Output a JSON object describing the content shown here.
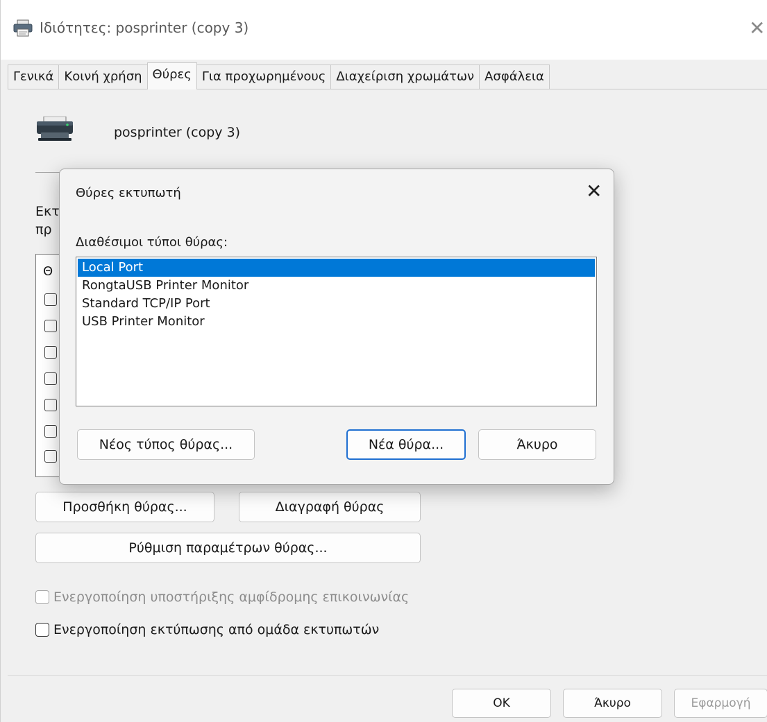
{
  "window": {
    "title": "Ιδιότητες: posprinter (copy 3)",
    "close_glyph": "✕"
  },
  "tabs": [
    {
      "label": "Γενικά",
      "active": false
    },
    {
      "label": "Κοινή χρήση",
      "active": false
    },
    {
      "label": "Θύρες",
      "active": true
    },
    {
      "label": "Για προχωρημένους",
      "active": false
    },
    {
      "label": "Διαχείριση χρωμάτων",
      "active": false
    },
    {
      "label": "Ασφάλεια",
      "active": false
    }
  ],
  "ports_page": {
    "printer_name": "posprinter (copy 3)",
    "partial_label_line1": "Εκτ",
    "partial_label_line2": "πρ",
    "column_header_partial": "Θ",
    "add_port_label": "Προσθήκη θύρας...",
    "delete_port_label": "Διαγραφή θύρας",
    "configure_port_label": "Ρύθμιση παραμέτρων θύρας...",
    "bidirectional_label": "Ενεργοποίηση υποστήριξης αμφίδρομης επικοινωνίας",
    "pooling_label": "Ενεργοποίηση εκτύπωσης από ομάδα εκτυπωτών"
  },
  "footer": {
    "ok_label": "OK",
    "cancel_label": "Άκυρο",
    "apply_label": "Εφαρμογή"
  },
  "dialog": {
    "title": "Θύρες εκτυπωτή",
    "close_glyph": "✕",
    "available_label": "Διαθέσιμοι τύποι θύρας:",
    "port_types": [
      {
        "label": "Local Port",
        "selected": true
      },
      {
        "label": "RongtaUSB Printer Monitor",
        "selected": false
      },
      {
        "label": "Standard TCP/IP Port",
        "selected": false
      },
      {
        "label": "USB Printer Monitor",
        "selected": false
      }
    ],
    "new_port_type_label": "Νέος τύπος θύρας...",
    "new_port_label": "Νέα θύρα...",
    "cancel_label": "Άκυρο"
  },
  "colors": {
    "selection": "#0078d7",
    "primary_border": "#1f6fd1",
    "window_bg": "#f0f0f0"
  }
}
